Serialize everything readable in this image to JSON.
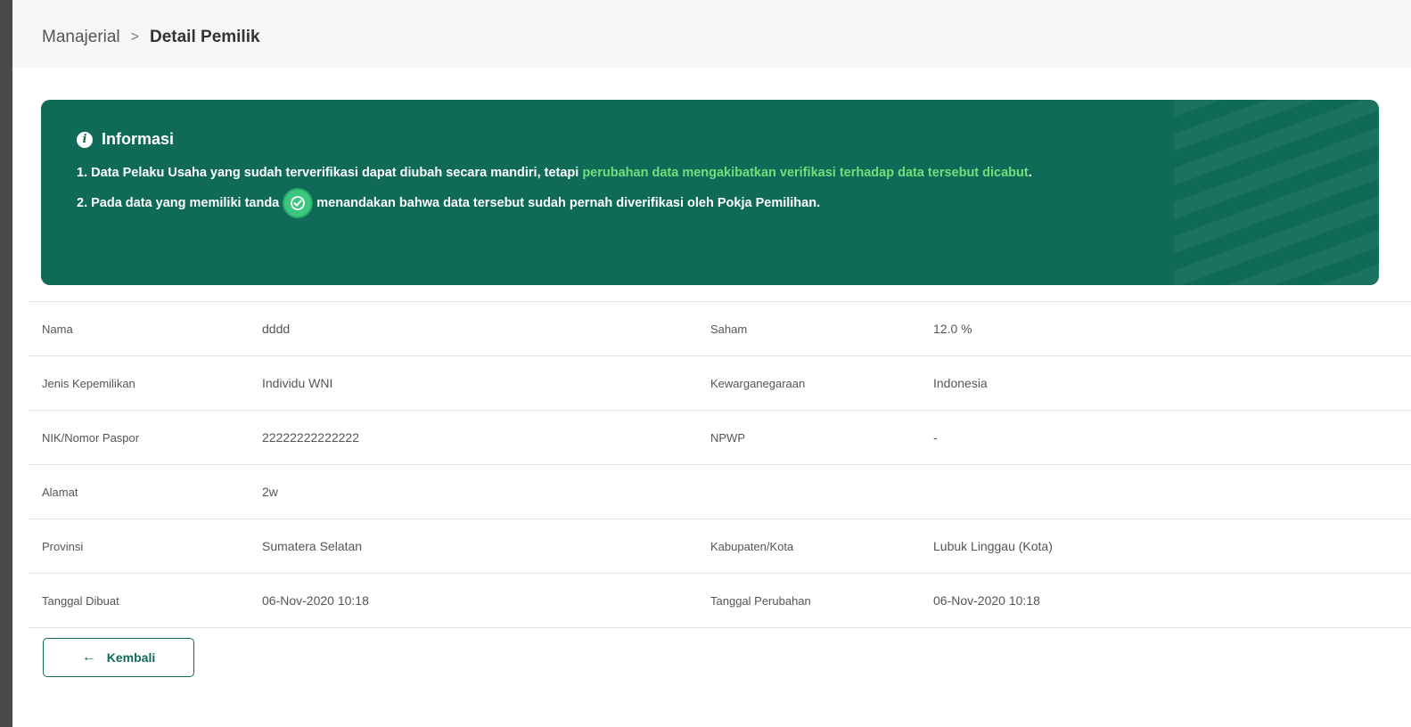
{
  "breadcrumb": {
    "parent": "Manajerial",
    "separator": ">",
    "current": "Detail Pemilik"
  },
  "info": {
    "icon": "info-circle-icon",
    "title": "Informasi",
    "line1_prefix": "1. Data Pelaku Usaha yang sudah terverifikasi dapat diubah secara mandiri, tetapi ",
    "line1_highlight": "perubahan data mengakibatkan verifikasi terhadap data tersebut dicabut",
    "line1_suffix": ".",
    "line2_prefix": "2. Pada data yang memiliki tanda",
    "line2_suffix": "menandakan bahwa data tersebut sudah pernah diverifikasi oleh Pokja Pemilihan.",
    "badge_icon": "verified-check-icon",
    "colors": {
      "card": "#0f6b58",
      "highlight": "#6ee07a",
      "badge": "#3cc77e"
    }
  },
  "details": {
    "rows": [
      {
        "label1": "Nama",
        "value1": "dddd",
        "label2": "Saham",
        "value2": "12.0 %"
      },
      {
        "label1": "Jenis Kepemilikan",
        "value1": "Individu WNI",
        "label2": "Kewarganegaraan",
        "value2": "Indonesia"
      },
      {
        "label1": "NIK/Nomor Paspor",
        "value1": "22222222222222",
        "label2": "NPWP",
        "value2": "-"
      },
      {
        "label1": "Alamat",
        "value1": "2w",
        "label2": "",
        "value2": ""
      },
      {
        "label1": "Provinsi",
        "value1": "Sumatera Selatan",
        "label2": "Kabupaten/Kota",
        "value2": "Lubuk Linggau (Kota)"
      },
      {
        "label1": "Tanggal Dibuat",
        "value1": "06-Nov-2020 10:18",
        "label2": "Tanggal Perubahan",
        "value2": "06-Nov-2020 10:18"
      }
    ]
  },
  "actions": {
    "back_label": "Kembali",
    "back_icon": "arrow-left-icon"
  }
}
